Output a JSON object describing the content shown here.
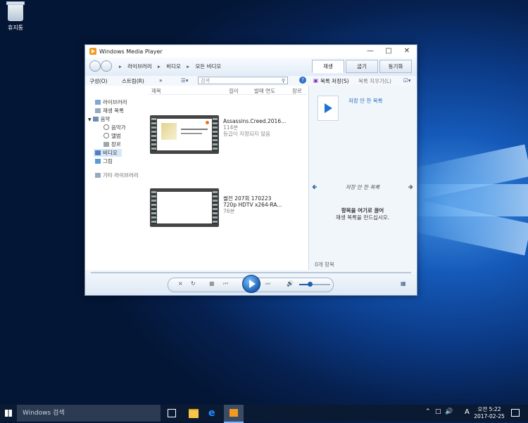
{
  "desktop": {
    "recycle_bin_label": "휴지통"
  },
  "window": {
    "title": "Windows Media Player",
    "breadcrumb": [
      "라이브러리",
      "비디오",
      "모든 비디오"
    ],
    "tabs": [
      {
        "label": "재생"
      },
      {
        "label": "굽기"
      },
      {
        "label": "동기화"
      }
    ],
    "toolbar": {
      "organize": "구성(O)",
      "stream": "스트림(R)",
      "more": "»",
      "search_placeholder": "검색",
      "help": "?"
    },
    "right_toolbar": {
      "save_list": "목록 저장(S)",
      "clear_list": "목록 지우기(L)"
    },
    "sidebar": {
      "items": [
        {
          "label": "라이브러리",
          "icon": "library-icon"
        },
        {
          "label": "재생 목록",
          "icon": "playlist-icon"
        },
        {
          "label": "음악",
          "icon": "music-icon"
        },
        {
          "label": "음악가",
          "icon": "artist-icon"
        },
        {
          "label": "앨범",
          "icon": "album-icon"
        },
        {
          "label": "장르",
          "icon": "genre-icon"
        },
        {
          "label": "비디오",
          "icon": "video-icon"
        },
        {
          "label": "그림",
          "icon": "picture-icon"
        },
        {
          "label": "기타 라이브러리",
          "icon": "other-library-icon"
        }
      ]
    },
    "columns": [
      "제목",
      "길이",
      "발매 연도",
      "장르"
    ],
    "videos": [
      {
        "title": "Assassins.Creed.2016...",
        "length": "114분",
        "rating": "등급이 지정되지 않음"
      },
      {
        "title_line1": "썰전 207회 170223",
        "title_line2": "720p HDTV x264-RA...",
        "length": "76분"
      }
    ],
    "playlist": {
      "unsaved_label": "저장 안 한 목록",
      "header": "저장 안 한 목록",
      "drag_title": "항목을 여기로 끌어",
      "drag_subtitle": "재생 목록을 만드십시오.",
      "count": "0개 항목"
    }
  },
  "taskbar": {
    "search_placeholder": "Windows 검색",
    "ampm": "오전 5:22",
    "date": "2017-02-25",
    "ime": "A"
  }
}
